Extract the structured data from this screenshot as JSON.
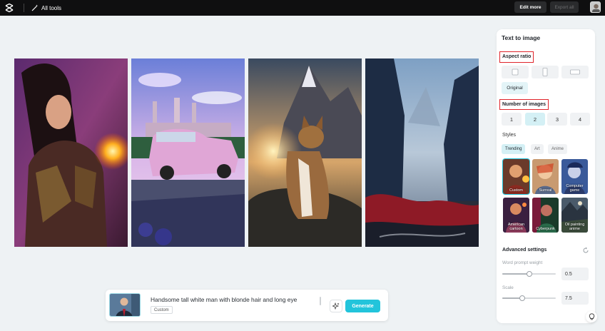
{
  "topbar": {
    "all_tools_label": "All tools",
    "edit_more_label": "Edit more",
    "export_all_label": "Export all"
  },
  "gallery": {
    "images": [
      {
        "name": "fantasy-woman-fire",
        "icon": "portrait-image"
      },
      {
        "name": "pink-car-castle",
        "icon": "car-image"
      },
      {
        "name": "cat-mountains",
        "icon": "cat-image"
      },
      {
        "name": "misty-valley",
        "icon": "landscape-image"
      }
    ]
  },
  "prompt": {
    "text": "Handsome tall white man with blonde hair and long eye",
    "style_tag": "Custom",
    "generate_label": "Generate"
  },
  "panel": {
    "title": "Text to image",
    "aspect_ratio_label": "Aspect ratio",
    "original_label": "Original",
    "number_of_images_label": "Number of images",
    "numbers": [
      "1",
      "2",
      "3",
      "4"
    ],
    "selected_number": "2",
    "styles_label": "Styles",
    "style_tabs": [
      "Trending",
      "Art",
      "Anime"
    ],
    "style_cards": [
      "Custom",
      "Surreal",
      "Computer game",
      "American cartoon",
      "Cyberpunk",
      "Oil painting anime"
    ],
    "advanced_label": "Advanced settings",
    "word_prompt_weight_label": "Word prompt weight",
    "word_prompt_weight_value": "0.5",
    "scale_label": "Scale",
    "scale_value": "7.5"
  },
  "colors": {
    "accent": "#22c4db",
    "highlight_box": "#e0242a",
    "background": "#eef2f4"
  }
}
